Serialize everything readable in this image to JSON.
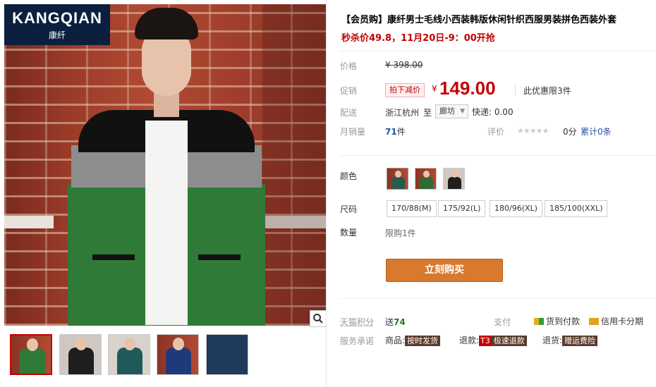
{
  "brand_logo": {
    "name": "KANGQIAN",
    "cn": "康纤"
  },
  "product": {
    "title": "【会员购】康纤男士毛线小西装韩版休闲针织西服男装拼色西装外套",
    "promo": "秒杀价49.8，11月20日-9：00开抢"
  },
  "price": {
    "label": "价格",
    "original": "¥ 398.00",
    "promo_label": "促销",
    "promo_tag": "拍下减价",
    "currency": "¥",
    "current": "149.00",
    "limit_note": "此优惠限3件"
  },
  "shipping": {
    "label": "配送",
    "from": "浙江杭州",
    "to_word": "至",
    "dest": "廊坊",
    "express": "快递: 0.00"
  },
  "sales": {
    "label": "月销量",
    "count": "71",
    "unit": "件",
    "rating_label": "评价",
    "stars": "★★★★★",
    "score": "0分",
    "reviews": "累计0条"
  },
  "color": {
    "label": "颜色",
    "swatches": [
      {
        "name": "swatch-green",
        "color": "#2a5a4a"
      },
      {
        "name": "swatch-darkgreen",
        "color": "#2f6a37"
      },
      {
        "name": "swatch-black",
        "color": "#1e1e1e"
      }
    ]
  },
  "size": {
    "label": "尺码",
    "options": [
      "170/88(M)",
      "175/92(L)",
      "180/96(XL)",
      "185/100(XXL)"
    ]
  },
  "quantity": {
    "label": "数量",
    "limit": "限购1件"
  },
  "buy_button": "立刻购买",
  "tmall_points": {
    "label": "天猫积分",
    "prefix": "送",
    "value": "74"
  },
  "payment": {
    "label": "支付",
    "cod": "货到付款",
    "credit": "信用卡分期"
  },
  "service": {
    "label": "服务承诺",
    "goods_label": "商品:",
    "goods_badge": "按时发货",
    "refund_label": "退款:",
    "refund_t3": "T3",
    "refund_badge": "极速退款",
    "return_label": "退货:",
    "return_badge": "赠运费险"
  },
  "thumbnails": [
    {
      "name": "thumb-1",
      "color": "#2f7a37"
    },
    {
      "name": "thumb-2",
      "color": "#1e1e1e"
    },
    {
      "name": "thumb-3",
      "color": "#1f5a5a"
    },
    {
      "name": "thumb-4",
      "color": "#1f3a7a"
    },
    {
      "name": "thumb-5",
      "color": "#1f3a5a"
    }
  ],
  "zoom_icon": "search-icon",
  "colors": {
    "accent_red": "#c40000",
    "buy_orange": "#d77a2f",
    "link_blue": "#2953a6"
  }
}
